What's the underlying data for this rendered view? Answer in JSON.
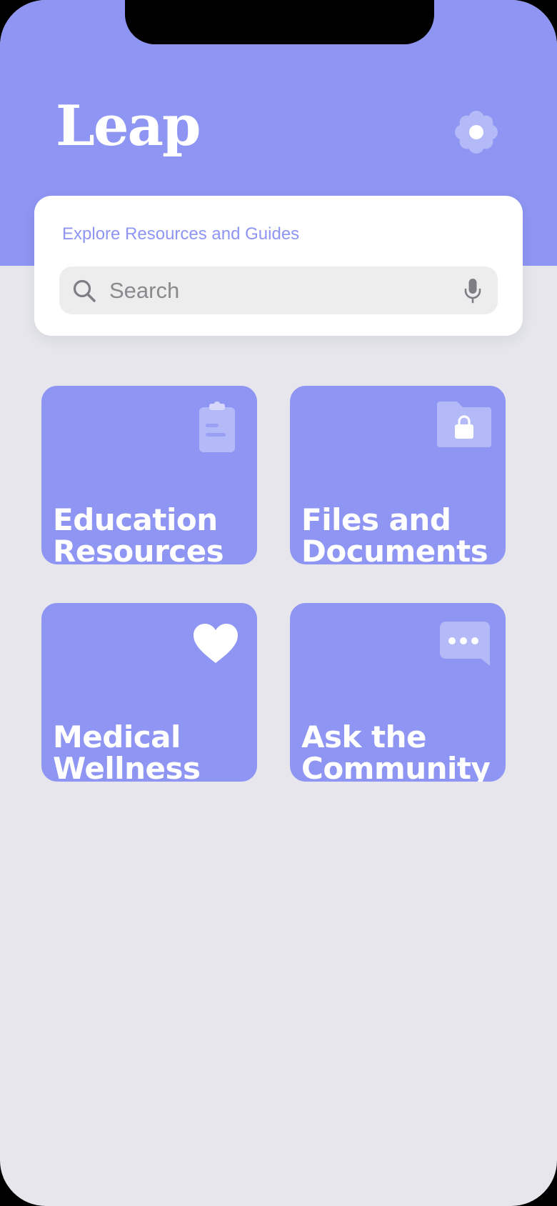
{
  "app": {
    "title": "Leap"
  },
  "colors": {
    "accent": "#8E95F2",
    "background": "#E6E6EC",
    "card": "#FFFFFF",
    "search_field": "#EDEDED"
  },
  "header": {
    "settings_icon": "flower-gear-icon"
  },
  "search": {
    "label": "Explore Resources and Guides",
    "placeholder": "Search",
    "value": "",
    "search_icon": "magnifying-glass-icon",
    "voice_icon": "microphone-icon"
  },
  "tiles": [
    {
      "line1": "Education",
      "line2": "Resources",
      "icon": "clipboard-icon"
    },
    {
      "line1": "Files and",
      "line2": "Documents",
      "icon": "locked-folder-icon"
    },
    {
      "line1": "Medical",
      "line2": "Wellness",
      "icon": "heart-icon"
    },
    {
      "line1": "Ask the",
      "line2": "Community",
      "icon": "chat-bubble-icon"
    }
  ]
}
